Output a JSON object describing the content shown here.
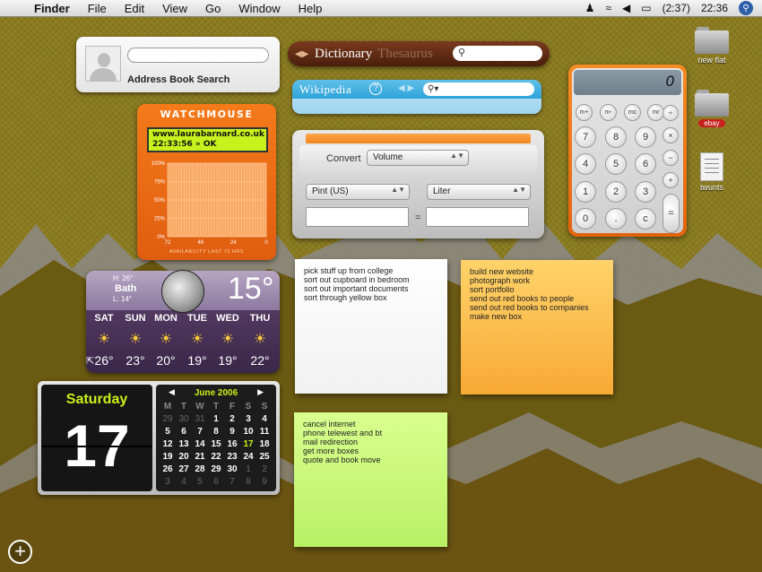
{
  "menubar": {
    "apple": "",
    "app": "Finder",
    "items": [
      "File",
      "Edit",
      "View",
      "Go",
      "Window",
      "Help"
    ],
    "battery": "(2:37)",
    "clock": "22:36",
    "icons": [
      "user-icon",
      "wifi-icon",
      "volume-icon",
      "battery-icon",
      "spotlight-icon"
    ]
  },
  "address_book": {
    "label": "Address Book Search",
    "search_value": ""
  },
  "dictionary": {
    "tab_dictionary": "Dictionary",
    "tab_thesaurus": "Thesaurus",
    "search_value": ""
  },
  "wikipedia": {
    "title": "Wikipedia",
    "help": "?",
    "search_value": ""
  },
  "watchmouse": {
    "brand": "WATCHMOUSE",
    "url": "www.laurabarnard.co.uk",
    "status": "22:33:56 » OK",
    "y_ticks": [
      "100%",
      "75%",
      "50%",
      "25%",
      "0%"
    ],
    "x_ticks": [
      "72",
      "48",
      "24",
      "0"
    ],
    "caption": "AVAILABILITY LAST 72 HRS",
    "availability_percent": 100
  },
  "converter": {
    "label": "Convert",
    "category": "Volume",
    "from_unit": "Pint (US)",
    "to_unit": "Liter",
    "equals": "=",
    "from_value": "",
    "to_value": ""
  },
  "calculator": {
    "display": "0",
    "mem_keys": [
      "m+",
      "m-",
      "mc",
      "mr"
    ],
    "ops": [
      "÷",
      "×",
      "−",
      "+"
    ],
    "digits": [
      "7",
      "8",
      "9",
      "4",
      "5",
      "6",
      "1",
      "2",
      "3",
      "0",
      ".",
      "c"
    ],
    "equals": "="
  },
  "weather": {
    "city": "Bath",
    "high": "H: 26°",
    "low": "L: 14°",
    "current_temp": "15°",
    "days": [
      "SAT",
      "SUN",
      "MON",
      "TUE",
      "WED",
      "THU"
    ],
    "temps": [
      "26°",
      "23°",
      "20°",
      "19°",
      "19°",
      "22°"
    ]
  },
  "date_widget": {
    "weekday": "Saturday",
    "day": "17",
    "month": "June 2006",
    "headers": [
      "M",
      "T",
      "W",
      "T",
      "F",
      "S",
      "S"
    ],
    "weeks": [
      [
        "29",
        "30",
        "31",
        "1",
        "2",
        "3",
        "4"
      ],
      [
        "5",
        "6",
        "7",
        "8",
        "9",
        "10",
        "11"
      ],
      [
        "12",
        "13",
        "14",
        "15",
        "16",
        "17",
        "18"
      ],
      [
        "19",
        "20",
        "21",
        "22",
        "23",
        "24",
        "25"
      ],
      [
        "26",
        "27",
        "28",
        "29",
        "30",
        "1",
        "2"
      ],
      [
        "3",
        "4",
        "5",
        "6",
        "7",
        "8",
        "9"
      ]
    ]
  },
  "notes": {
    "white": [
      "pick stuff up from college",
      "sort out cupboard in bedroom",
      "sort out important documents",
      "sort through yellow box"
    ],
    "orange": [
      "build new website",
      "photograph work",
      "sort portfolio",
      "send out red books to people",
      "send out red books to companies",
      "make new box"
    ],
    "green": [
      "cancel internet",
      "phone telewest and bt",
      "mail redirection",
      "get more boxes",
      "quote and book move"
    ]
  },
  "desktop": {
    "icons": [
      {
        "label": "new flat",
        "badge": ""
      },
      {
        "label": "",
        "badge": "ebay"
      },
      {
        "label": "twunts",
        "badge": ""
      }
    ]
  },
  "dashboard": {
    "add_widget": "+"
  }
}
